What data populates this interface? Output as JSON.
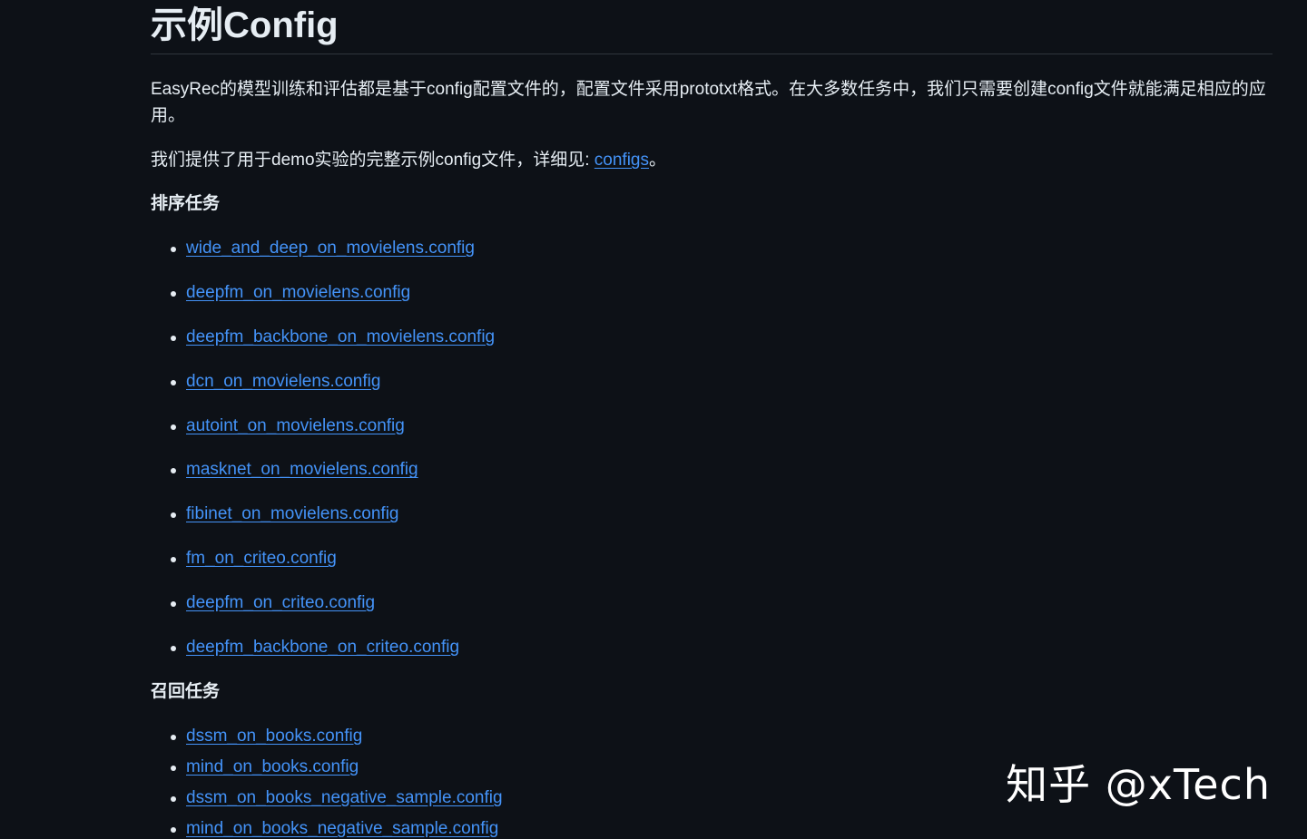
{
  "title": "示例Config",
  "intro": {
    "text": "EasyRec的模型训练和评估都是基于config配置文件的，配置文件采用prototxt格式。在大多数任务中，我们只需要创建config文件就能满足相应的应用。",
    "provided_prefix": "我们提供了用于demo实验的完整示例config文件，详细见: ",
    "configs_link": "configs",
    "provided_suffix": "。"
  },
  "ranking": {
    "heading": "排序任务",
    "items": [
      "wide_and_deep_on_movielens.config",
      "deepfm_on_movielens.config",
      "deepfm_backbone_on_movielens.config",
      "dcn_on_movielens.config",
      "autoint_on_movielens.config",
      "masknet_on_movielens.config",
      "fibinet_on_movielens.config",
      "fm_on_criteo.config",
      "deepfm_on_criteo.config",
      "deepfm_backbone_on_criteo.config"
    ]
  },
  "recall": {
    "heading": "召回任务",
    "items": [
      "dssm_on_books.config",
      "mind_on_books.config",
      "dssm_on_books_negative_sample.config",
      "mind_on_books_negative_sample.config"
    ]
  },
  "watermark": "知乎 @xTech",
  "colors": {
    "background": "#0d1117",
    "text": "#e6edf3",
    "link": "#4493f8",
    "divider": "#30363d"
  }
}
